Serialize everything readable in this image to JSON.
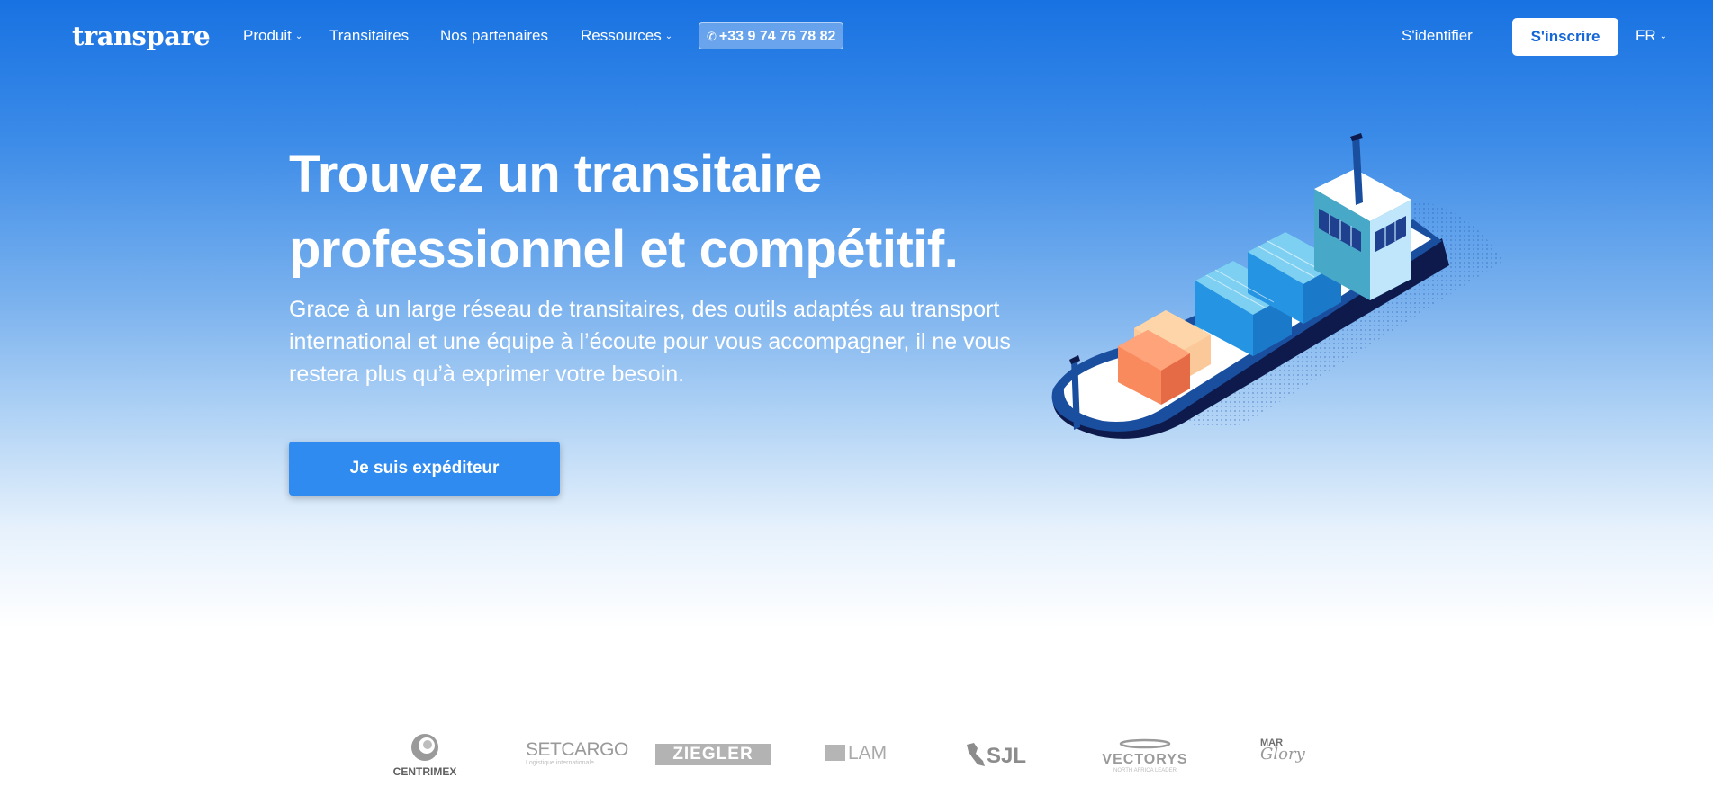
{
  "nav": {
    "logo": "transpare",
    "items": [
      {
        "label": "Produit",
        "dropdown": true
      },
      {
        "label": "Transitaires",
        "dropdown": false
      },
      {
        "label": "Nos partenaires",
        "dropdown": false
      },
      {
        "label": "Ressources",
        "dropdown": true
      }
    ],
    "phone": "+33 9 74 76 78 82",
    "login_label": "S'identifier",
    "signup_label": "S'inscrire",
    "language": "FR"
  },
  "hero": {
    "title_line1": "Trouvez un transitaire",
    "title_line2": "professionnel et compétitif.",
    "subtitle": "Grace à un large réseau de transitaires, des outils adaptés au transport international et une équipe à l’écoute pour vous accompagner, il ne vous restera plus qu’à exprimer votre besoin.",
    "cta_label": "Je suis expéditeur"
  },
  "partners": [
    {
      "name": "CENTRIMEX"
    },
    {
      "name": "SETCARGO",
      "tagline": "Logistique internationale"
    },
    {
      "name": "ZIEGLER"
    },
    {
      "name": "LAM"
    },
    {
      "name": "SJL"
    },
    {
      "name": "VECTORYS",
      "tagline": "NORTH AFRICA LEADER"
    },
    {
      "name_top": "MAR",
      "name_bottom": "Glory"
    }
  ],
  "colors": {
    "brand_blue": "#1872e2",
    "cta_blue": "#2f8bf0",
    "white": "#ffffff",
    "logo_gray": "#8e8e8e"
  }
}
